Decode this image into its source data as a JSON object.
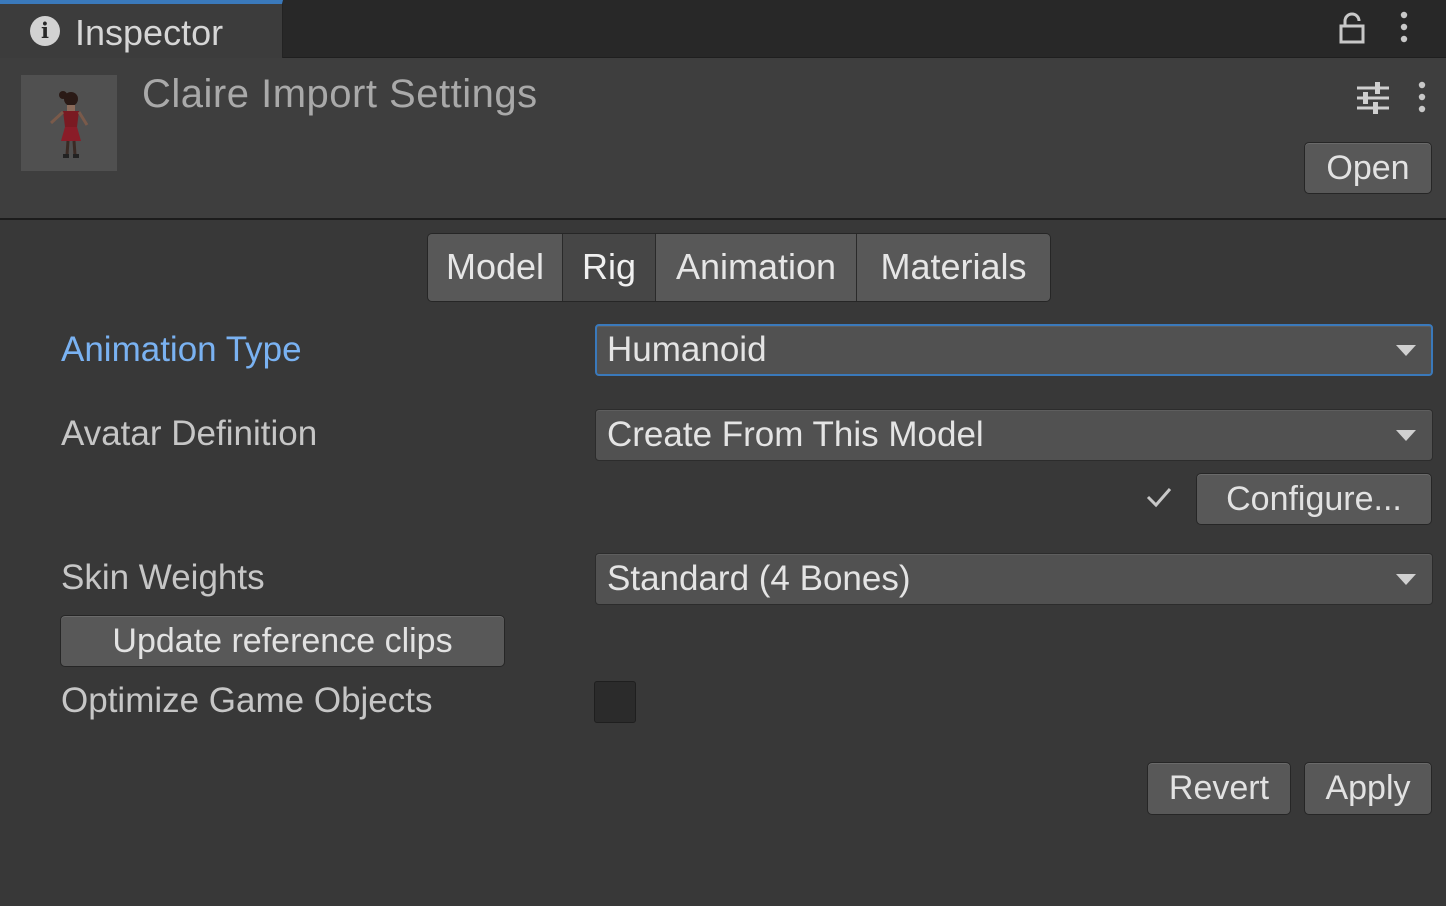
{
  "window": {
    "tab_title": "Inspector",
    "tab_icon": "info-icon",
    "icons": [
      "lock-icon",
      "more-vertical-icon"
    ]
  },
  "header": {
    "title": "Claire Import Settings",
    "thumbnail": "character-model-thumbnail",
    "icons": [
      "sliders-icon",
      "more-vertical-icon"
    ],
    "open_label": "Open"
  },
  "tabs": [
    {
      "label": "Model",
      "active": false
    },
    {
      "label": "Rig",
      "active": true
    },
    {
      "label": "Animation",
      "active": false
    },
    {
      "label": "Materials",
      "active": false
    }
  ],
  "rig": {
    "animation_type": {
      "label": "Animation Type",
      "value": "Humanoid"
    },
    "avatar_definition": {
      "label": "Avatar Definition",
      "value": "Create From This Model"
    },
    "configure_label": "Configure...",
    "configured": true,
    "skin_weights": {
      "label": "Skin Weights",
      "value": "Standard (4 Bones)"
    },
    "update_clips_label": "Update reference clips",
    "optimize_game_objects": {
      "label": "Optimize Game Objects",
      "checked": false
    }
  },
  "actions": {
    "revert_label": "Revert",
    "apply_label": "Apply"
  },
  "colors": {
    "accent": "#3a79bb",
    "focused_label": "#7ab2f2",
    "background": "#383838"
  }
}
